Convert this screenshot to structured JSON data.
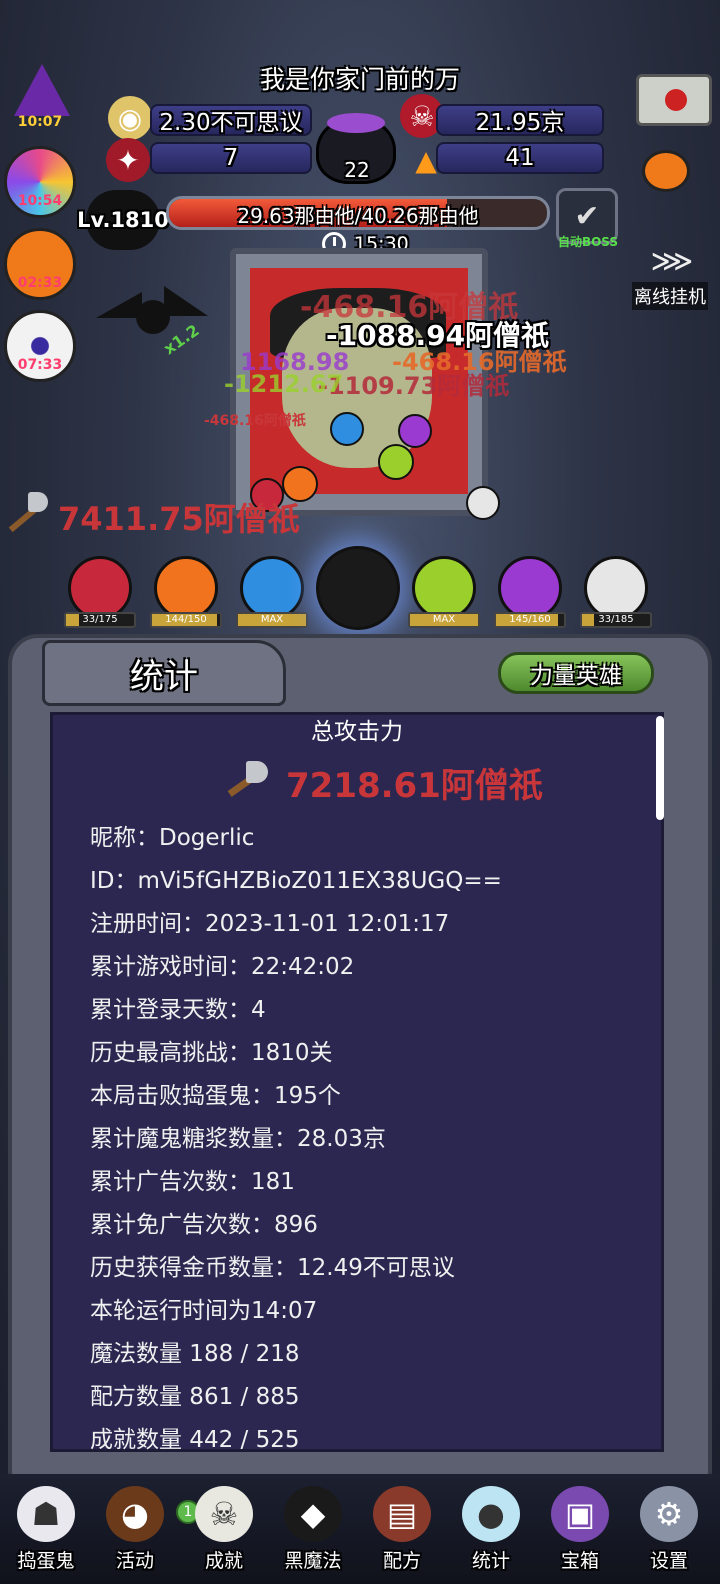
{
  "player": {
    "name": "我是你家门前的万"
  },
  "resources": {
    "gold": "2.30不可思议",
    "syrup": "21.95京",
    "candy_red": "7",
    "cauldron": "22",
    "candy_corn": "41"
  },
  "side_timers": {
    "witch": "10:07",
    "lollipop": "10:54",
    "pumpkin": "02:33",
    "eyeball": "07:33"
  },
  "boss": {
    "level": "Lv.1810",
    "hp_text": "29.63那由他/40.26那由他",
    "hp_fraction": 0.736,
    "timer": "15:30",
    "auto_boss_label": "自动BOSS"
  },
  "offline": {
    "label": "离线挂机"
  },
  "battle": {
    "bat_multiplier": "x1.2",
    "damage_numbers": [
      "-468.16阿僧祇",
      "-1088.94阿僧祇",
      "-468.16阿僧祇",
      "-1109.73阿僧祇",
      "-1212.67",
      "1168.98",
      "-468.16阿僧祇"
    ],
    "axe_damage": "7411.75阿僧祇"
  },
  "heroes": [
    {
      "color": "#c8283c",
      "bar": "33/175",
      "fill": 0.19
    },
    {
      "color": "#f2731d",
      "bar": "144/150",
      "fill": 0.96
    },
    {
      "color": "#2f8ee0",
      "bar": "MAX",
      "fill": 1.0
    },
    {
      "color": "#1a1a1a",
      "bar": "",
      "fill": 0
    },
    {
      "color": "#9bd02c",
      "bar": "MAX",
      "fill": 1.0
    },
    {
      "color": "#9a3ad0",
      "bar": "145/160",
      "fill": 0.91
    },
    {
      "color": "#e6e6e6",
      "bar": "33/185",
      "fill": 0.18
    }
  ],
  "panel": {
    "tab_stats": "统计",
    "tab_hero": "力量英雄",
    "title": "总攻击力",
    "total_attack": "7218.61阿僧祇",
    "rows": [
      "昵称：Dogerlic",
      "ID：mVi5fGHZBioZ011EX38UGQ==",
      "注册时间：2023-11-01 12:01:17",
      "累计游戏时间：22:42:02",
      "累计登录天数：4",
      "历史最高挑战：1810关",
      "本局击败捣蛋鬼：195个",
      "累计魔鬼糖浆数量：28.03京",
      "累计广告次数：181",
      "累计免广告次数：896",
      "历史获得金币数量：12.49不可思议",
      "本轮运行时间为14:07",
      "魔法数量 188 / 218",
      "配方数量 861 / 885",
      "成就数量 442 / 525"
    ]
  },
  "nav": {
    "badge": "1",
    "items": [
      "捣蛋鬼",
      "活动",
      "成就",
      "黑魔法",
      "配方",
      "统计",
      "宝箱",
      "设置"
    ]
  }
}
